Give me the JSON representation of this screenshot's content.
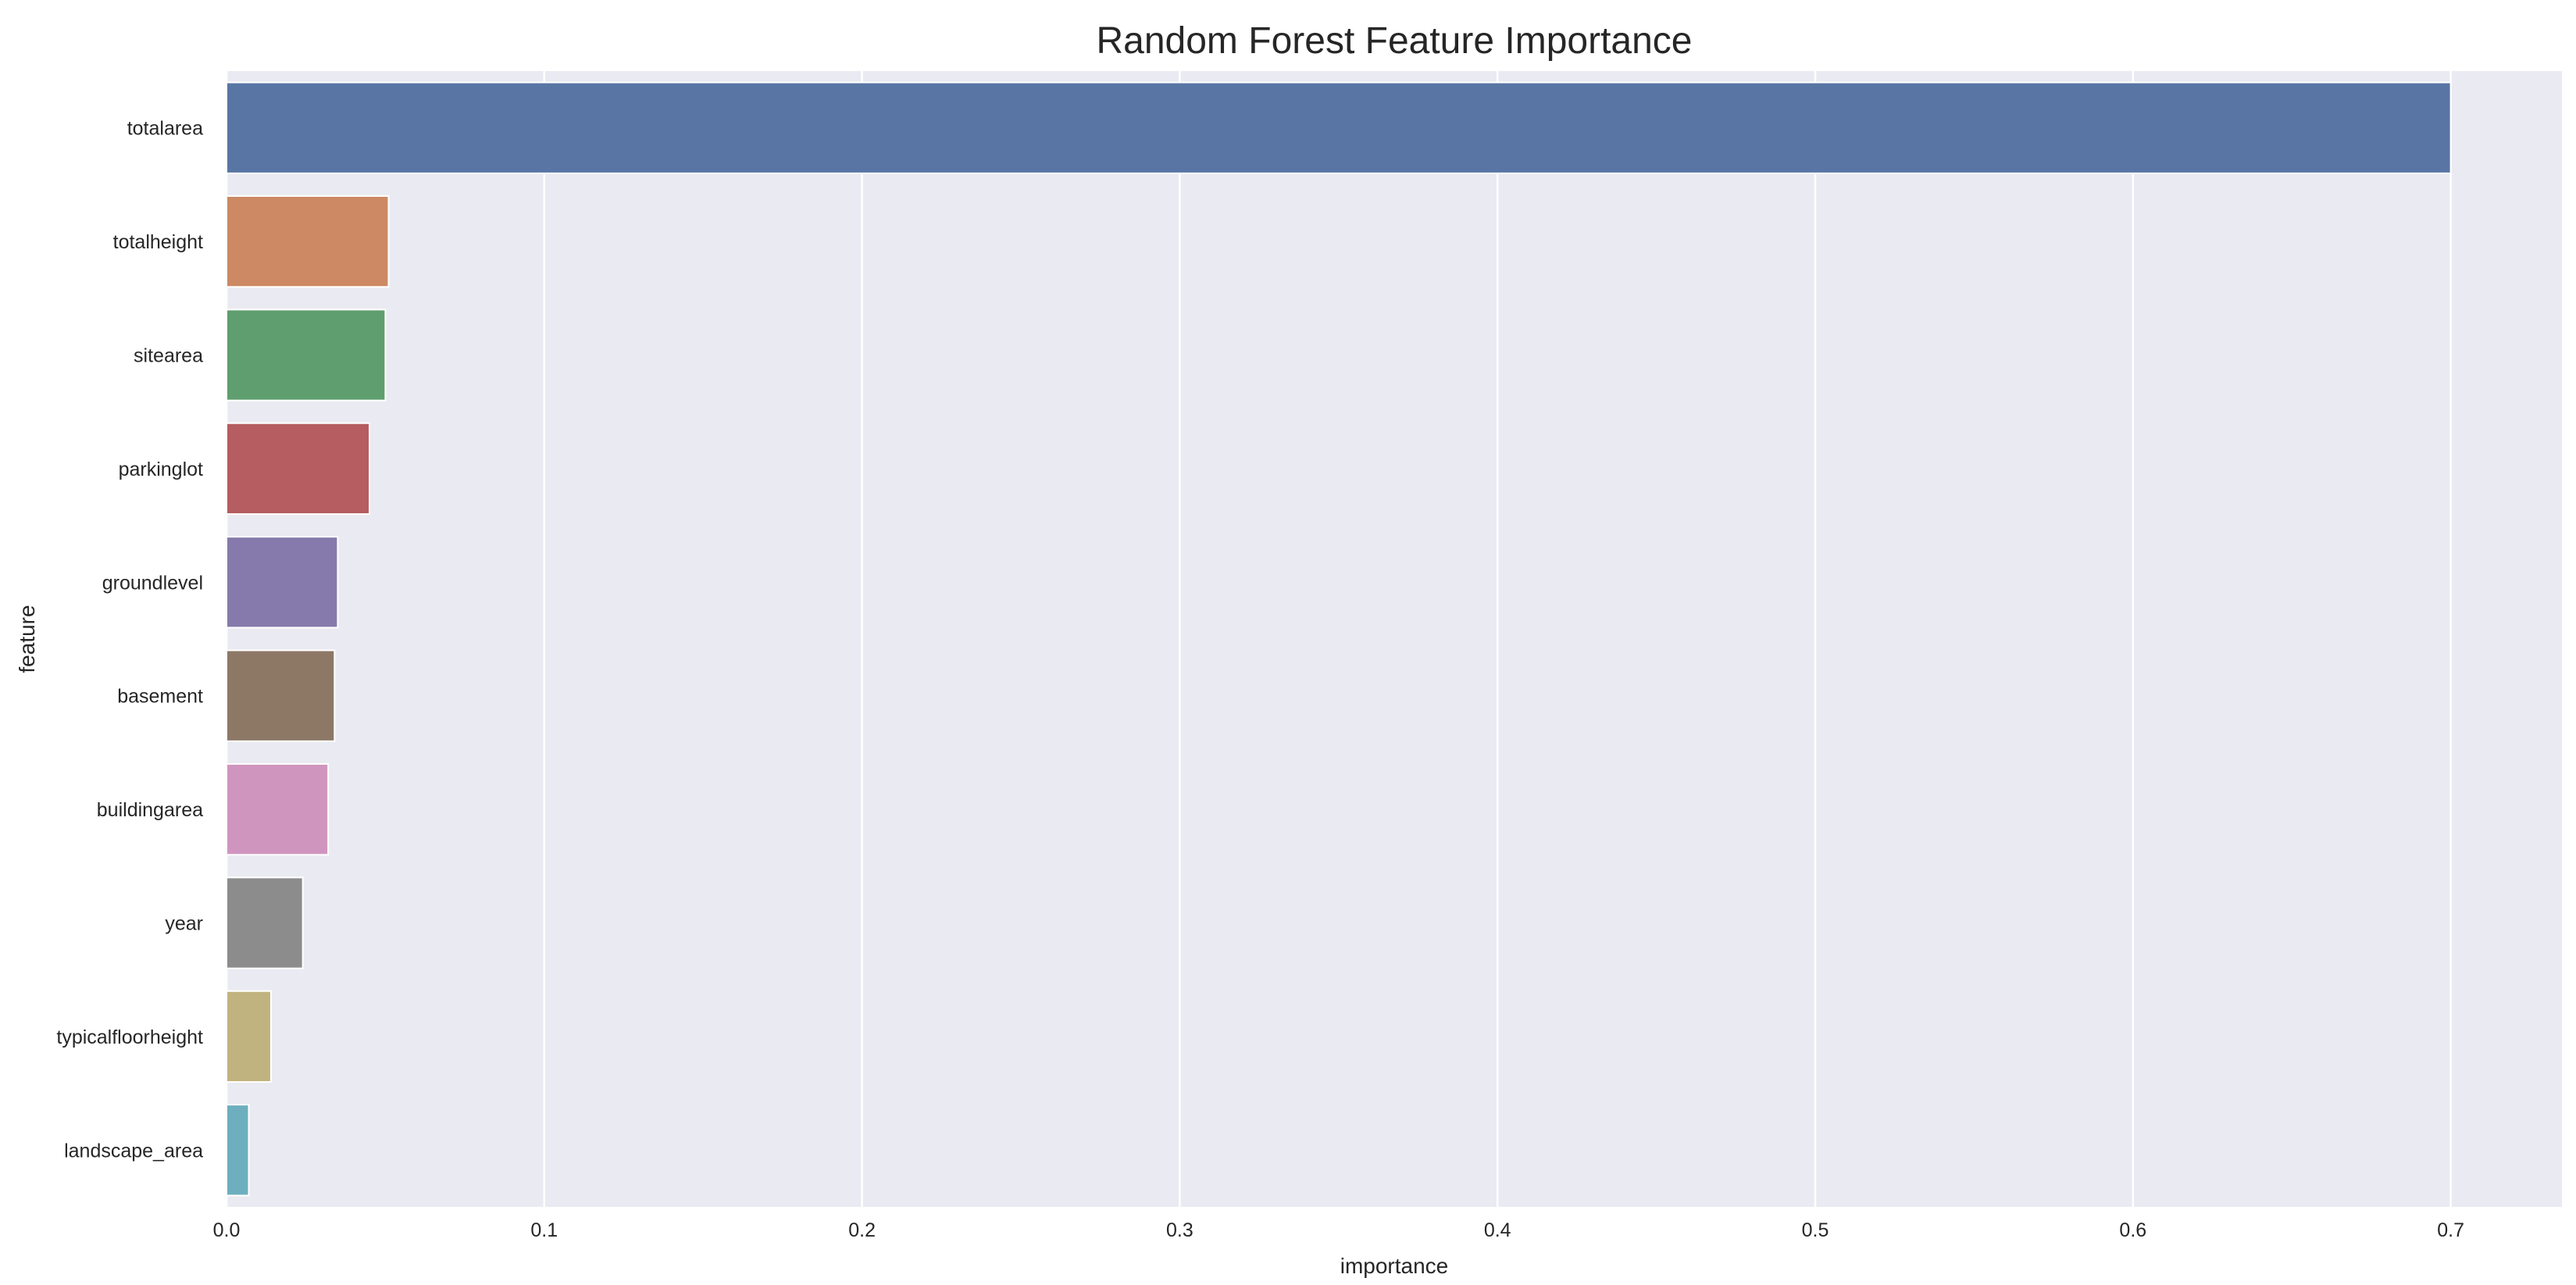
{
  "chart_data": {
    "type": "bar",
    "orientation": "horizontal",
    "title": "Random Forest Feature Importance",
    "xlabel": "importance",
    "ylabel": "feature",
    "xlim": [
      0,
      0.735
    ],
    "xticks": [
      0.0,
      0.1,
      0.2,
      0.3,
      0.4,
      0.5,
      0.6,
      0.7
    ],
    "xtick_labels": [
      "0.0",
      "0.1",
      "0.2",
      "0.3",
      "0.4",
      "0.5",
      "0.6",
      "0.7"
    ],
    "grid": true,
    "categories": [
      "totalarea",
      "totalheight",
      "sitearea",
      "parkinglot",
      "groundlevel",
      "basement",
      "buildingarea",
      "year",
      "typicalfloorheight",
      "landscape_area"
    ],
    "values": [
      0.7,
      0.051,
      0.05,
      0.045,
      0.035,
      0.034,
      0.032,
      0.024,
      0.014,
      0.007
    ],
    "colors": [
      "#5975a4",
      "#cc8963",
      "#5f9e6e",
      "#b55d60",
      "#857aab",
      "#8d7866",
      "#d095bf",
      "#8c8c8c",
      "#c1b37f",
      "#6daebf"
    ],
    "background_color": "#eaeaf2",
    "grid_color": "#ffffff"
  }
}
